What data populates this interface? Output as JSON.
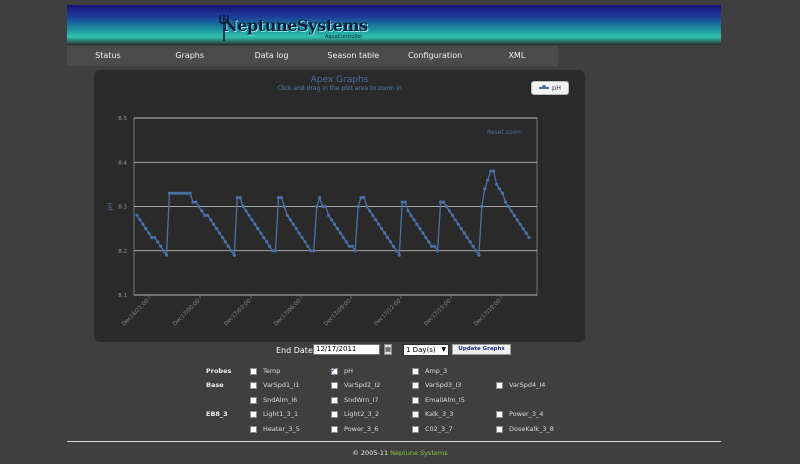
{
  "header": {
    "logo_text": "NeptuneSystems",
    "logo_subtext": "AquaController",
    "logo_icon": "trident-icon"
  },
  "nav": {
    "items": [
      "Status",
      "Graphs",
      "Data log",
      "Season table",
      "Configuration",
      "XML"
    ]
  },
  "graph": {
    "title": "Apex Graphs",
    "subtitle": "Click and drag in the plot area to zoom in",
    "legend_label": "pH",
    "reset_zoom_label": "Reset zoom"
  },
  "chart_data": {
    "type": "line",
    "ylabel": "pH",
    "ylim": [
      8.1,
      8.5
    ],
    "yticks": [
      "8.1",
      "8.2",
      "8.3",
      "8.4",
      "8.5"
    ],
    "xticks": [
      "Dec16/21:00",
      "Dec17/00:00",
      "Dec17/03:00",
      "Dec17/06:00",
      "Dec17/09:00",
      "Dec17/12:00",
      "Dec17/15:00",
      "Dec17/18:00"
    ],
    "grid": true,
    "line_color": "#4a72a8",
    "series": [
      {
        "name": "pH",
        "values": [
          8.28,
          8.27,
          8.26,
          8.25,
          8.24,
          8.23,
          8.23,
          8.22,
          8.21,
          8.2,
          8.19,
          8.33,
          8.33,
          8.33,
          8.33,
          8.33,
          8.33,
          8.33,
          8.33,
          8.31,
          8.31,
          8.3,
          8.29,
          8.28,
          8.28,
          8.27,
          8.26,
          8.25,
          8.24,
          8.23,
          8.22,
          8.21,
          8.2,
          8.19,
          8.32,
          8.32,
          8.3,
          8.29,
          8.28,
          8.27,
          8.26,
          8.25,
          8.24,
          8.23,
          8.22,
          8.21,
          8.2,
          8.2,
          8.32,
          8.32,
          8.3,
          8.28,
          8.27,
          8.26,
          8.25,
          8.24,
          8.23,
          8.22,
          8.21,
          8.2,
          8.2,
          8.3,
          8.32,
          8.3,
          8.3,
          8.28,
          8.27,
          8.26,
          8.25,
          8.24,
          8.23,
          8.22,
          8.21,
          8.21,
          8.2,
          8.3,
          8.32,
          8.32,
          8.3,
          8.29,
          8.28,
          8.27,
          8.26,
          8.25,
          8.24,
          8.23,
          8.22,
          8.21,
          8.2,
          8.19,
          8.31,
          8.31,
          8.29,
          8.28,
          8.27,
          8.26,
          8.25,
          8.24,
          8.23,
          8.22,
          8.21,
          8.21,
          8.2,
          8.31,
          8.31,
          8.3,
          8.29,
          8.28,
          8.27,
          8.26,
          8.25,
          8.24,
          8.23,
          8.22,
          8.21,
          8.2,
          8.19,
          8.3,
          8.34,
          8.36,
          8.38,
          8.38,
          8.35,
          8.34,
          8.33,
          8.31,
          8.3,
          8.29,
          8.28,
          8.27,
          8.26,
          8.25,
          8.24,
          8.23
        ]
      }
    ]
  },
  "controls": {
    "end_date_label": "End Date",
    "end_date_value": "12/17/2011",
    "range_value": "1 Day(s)",
    "update_label": "Update Graphs"
  },
  "checkbox_grid": {
    "rows": [
      {
        "label": "Probes",
        "items": [
          {
            "label": "Temp",
            "checked": false
          },
          {
            "label": "pH",
            "checked": true
          },
          {
            "label": "Amp_3",
            "checked": false
          }
        ]
      },
      {
        "label": "Base",
        "items": [
          {
            "label": "VarSpd1_I1",
            "checked": false
          },
          {
            "label": "VarSpd2_I2",
            "checked": false
          },
          {
            "label": "VarSpd3_I3",
            "checked": false
          },
          {
            "label": "VarSpd4_I4",
            "checked": false
          }
        ]
      },
      {
        "label": "",
        "items": [
          {
            "label": "SndAlm_I6",
            "checked": false
          },
          {
            "label": "SndWrn_I7",
            "checked": false
          },
          {
            "label": "EmailAlm_I5",
            "checked": false
          }
        ]
      },
      {
        "label": "EB8_3",
        "items": [
          {
            "label": "Light1_3_1",
            "checked": false
          },
          {
            "label": "Light2_3_2",
            "checked": false
          },
          {
            "label": "Kalk_3_3",
            "checked": false
          },
          {
            "label": "Power_3_4",
            "checked": false
          }
        ]
      },
      {
        "label": "",
        "items": [
          {
            "label": "Heater_3_5",
            "checked": false
          },
          {
            "label": "Power_3_6",
            "checked": false
          },
          {
            "label": "C02_3_7",
            "checked": false
          },
          {
            "label": "DoseKalk_3_8",
            "checked": false
          }
        ]
      }
    ]
  },
  "footer": {
    "copyright": "© 2005-11",
    "link_text": "Neptune Systems"
  }
}
